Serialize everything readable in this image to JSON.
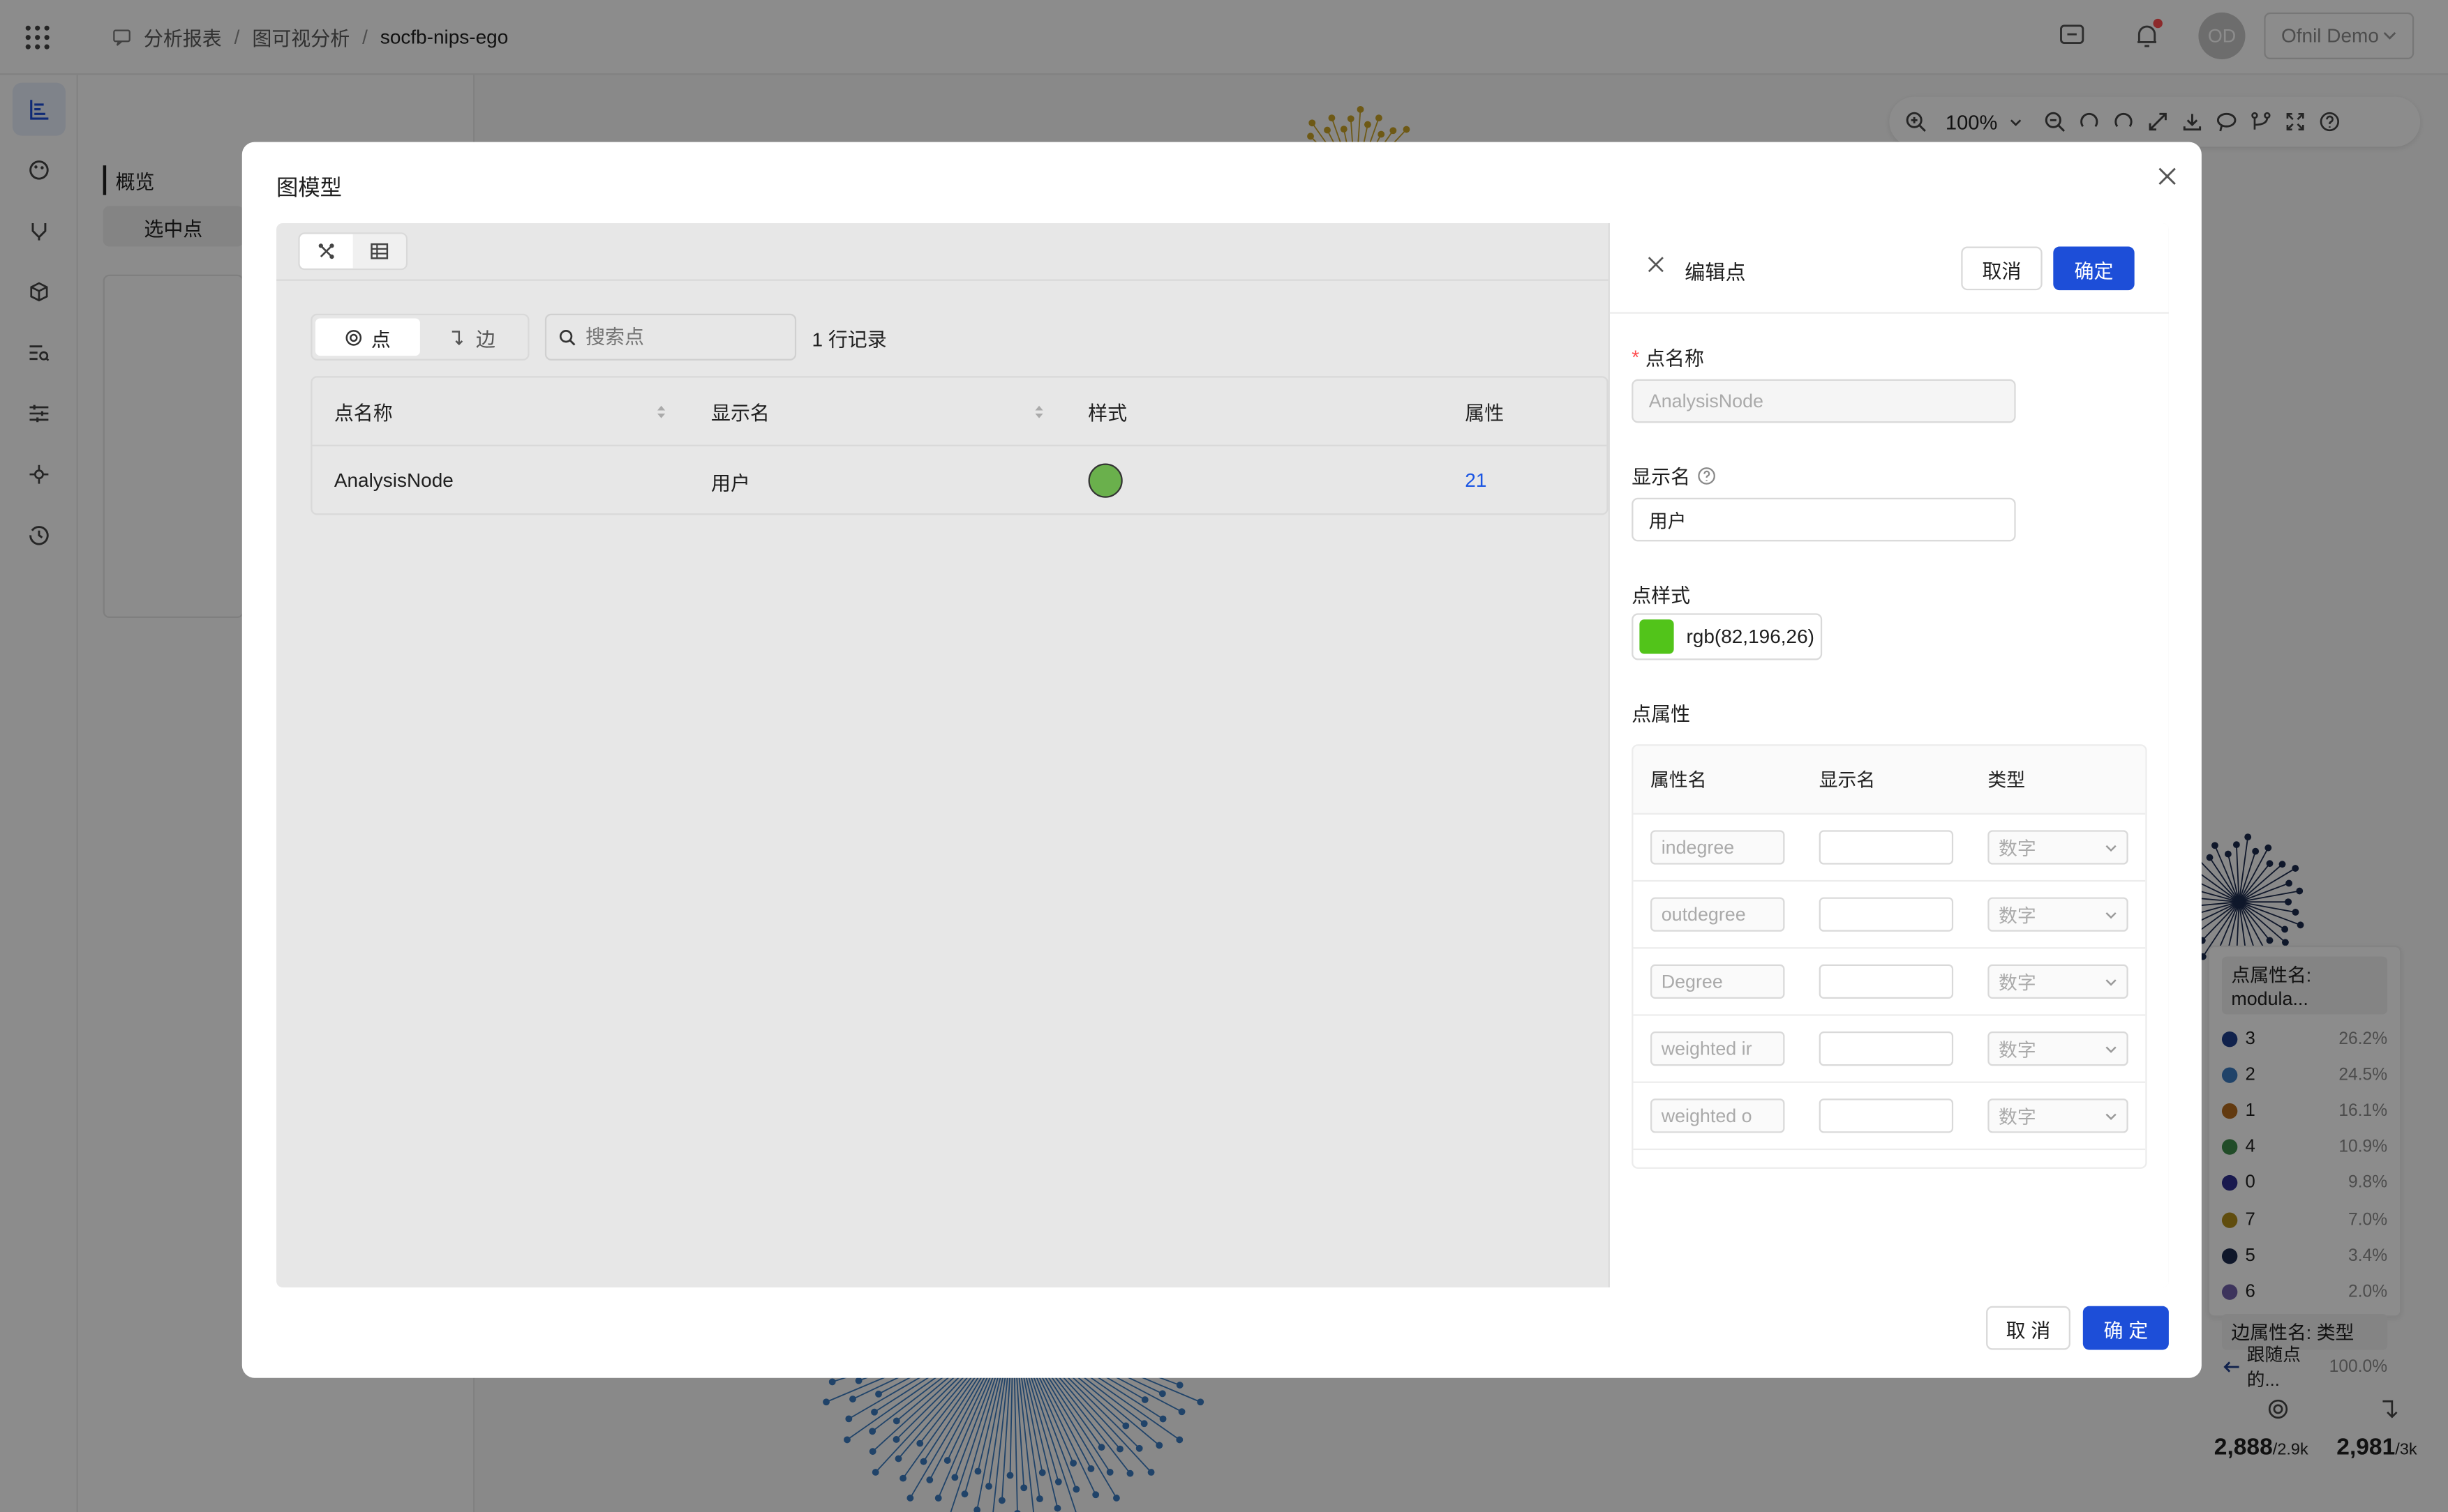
{
  "header": {
    "breadcrumb": [
      "分析报表",
      "图可视分析",
      "socfb-nips-ego"
    ],
    "sep": "/",
    "user_avatar": "OD",
    "user_name": "Ofnil Demo"
  },
  "side_panel": {
    "overview_label": "概览",
    "selected_label": "选中点"
  },
  "canvas": {
    "zoom": "100%",
    "legend": {
      "node_title": "点属性名: modula...",
      "items": [
        {
          "label": "3",
          "pct": "26.2%",
          "color": "#1f3f8a"
        },
        {
          "label": "2",
          "pct": "24.5%",
          "color": "#3b7bbf"
        },
        {
          "label": "1",
          "pct": "16.1%",
          "color": "#b36b1e"
        },
        {
          "label": "4",
          "pct": "10.9%",
          "color": "#3c8a4a"
        },
        {
          "label": "0",
          "pct": "9.8%",
          "color": "#2f2f8f"
        },
        {
          "label": "7",
          "pct": "7.0%",
          "color": "#b08c1a"
        },
        {
          "label": "5",
          "pct": "3.4%",
          "color": "#1c2b4e"
        },
        {
          "label": "6",
          "pct": "2.0%",
          "color": "#6f5fa8"
        }
      ],
      "edge_title": "边属性名: 类型",
      "edge_item": "跟随点的...",
      "edge_pct": "100.0%"
    },
    "stats": {
      "nodes_value": "2,888",
      "nodes_total": "/2.9k",
      "edges_value": "2,981",
      "edges_total": "/3k"
    }
  },
  "modal": {
    "title": "图模型",
    "seg_node": "点",
    "seg_edge": "边",
    "search_placeholder": "搜索点",
    "record_count": "1 行记录",
    "columns": [
      "点名称",
      "显示名",
      "样式",
      "属性"
    ],
    "rows": [
      {
        "name": "AnalysisNode",
        "display": "用户",
        "style_color": "#6ab04c",
        "props": "21"
      }
    ],
    "cancel": "取 消",
    "ok": "确 定"
  },
  "edit_panel": {
    "title": "编辑点",
    "cancel": "取消",
    "ok": "确定",
    "name_label": "点名称",
    "name_value": "AnalysisNode",
    "display_label": "显示名",
    "display_value": "用户",
    "style_label": "点样式",
    "style_value": "rgb(82,196,26)",
    "style_color": "#52c41a",
    "props_label": "点属性",
    "prop_columns": [
      "属性名",
      "显示名",
      "类型"
    ],
    "props": [
      {
        "name": "indegree",
        "display": "",
        "type": "数字"
      },
      {
        "name": "outdegree",
        "display": "",
        "type": "数字"
      },
      {
        "name": "Degree",
        "display": "",
        "type": "数字"
      },
      {
        "name": "weighted ir",
        "display": "",
        "type": "数字"
      },
      {
        "name": "weighted o",
        "display": "",
        "type": "数字"
      }
    ]
  }
}
